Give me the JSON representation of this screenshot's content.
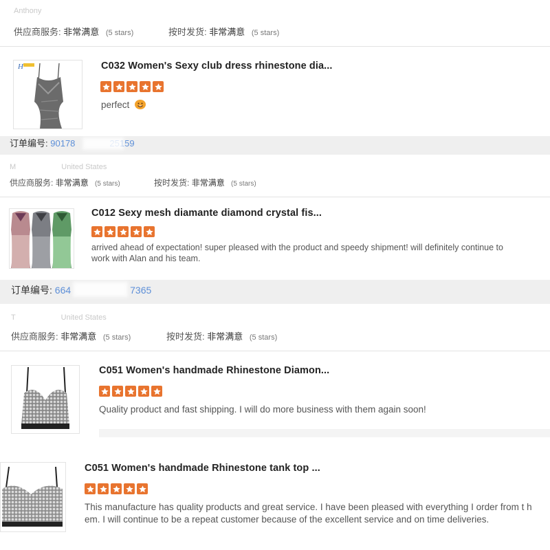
{
  "top": {
    "name_faded": "Anthony",
    "supplier_label": "供应商服务:",
    "supplier_value": "非常满意",
    "supplier_stars": "(5 stars)",
    "ontime_label": "按时发货:",
    "ontime_value": "非常满意",
    "ontime_stars": "(5 stars)"
  },
  "reviews": [
    {
      "title": "C032 Women's Sexy club dress rhinestone dia...",
      "rating": 5,
      "text": "perfect",
      "image_badge": "H"
    },
    {
      "title": "C012 Sexy mesh diamante diamond crystal fis...",
      "rating": 5,
      "text": "arrived ahead of expectation! super pleased with the product and speedy shipment! will definitely continue to work with Alan and his team."
    },
    {
      "title": "C051 Women's handmade Rhinestone Diamon...",
      "rating": 5,
      "text": "Quality product and fast shipping.  I will do more business with them again soon!"
    },
    {
      "title": "C051 Women's handmade Rhinestone tank top ...",
      "rating": 5,
      "text": "This manufacture has quality products and great service. I have been pleased with everything I order from t hem.  I will continue to be a repeat customer because of the excellent service and on time deliveries."
    }
  ],
  "orders": [
    {
      "label": "订单编号:",
      "number": "90178",
      "number_tail": "25159"
    },
    {
      "label": "订单编号:",
      "number": "664",
      "number_tail": "7365"
    }
  ],
  "buyers": [
    {
      "name_faded": "M",
      "country_faded": "United States",
      "supplier_label": "供应商服务:",
      "supplier_value": "非常满意",
      "supplier_stars": "(5 stars)",
      "ontime_label": "按时发货:",
      "ontime_value": "非常满意",
      "ontime_stars": "(5 stars)"
    },
    {
      "name_faded": "T",
      "country_faded": "United States",
      "supplier_label": "供应商服务:",
      "supplier_value": "非常满意",
      "supplier_stars": "(5 stars)",
      "ontime_label": "按时发货:",
      "ontime_value": "非常满意",
      "ontime_stars": "(5 stars)"
    }
  ],
  "colors": {
    "star": "#e8742f",
    "order_number": "#5d8fd8",
    "order_bar": "#efefef"
  }
}
